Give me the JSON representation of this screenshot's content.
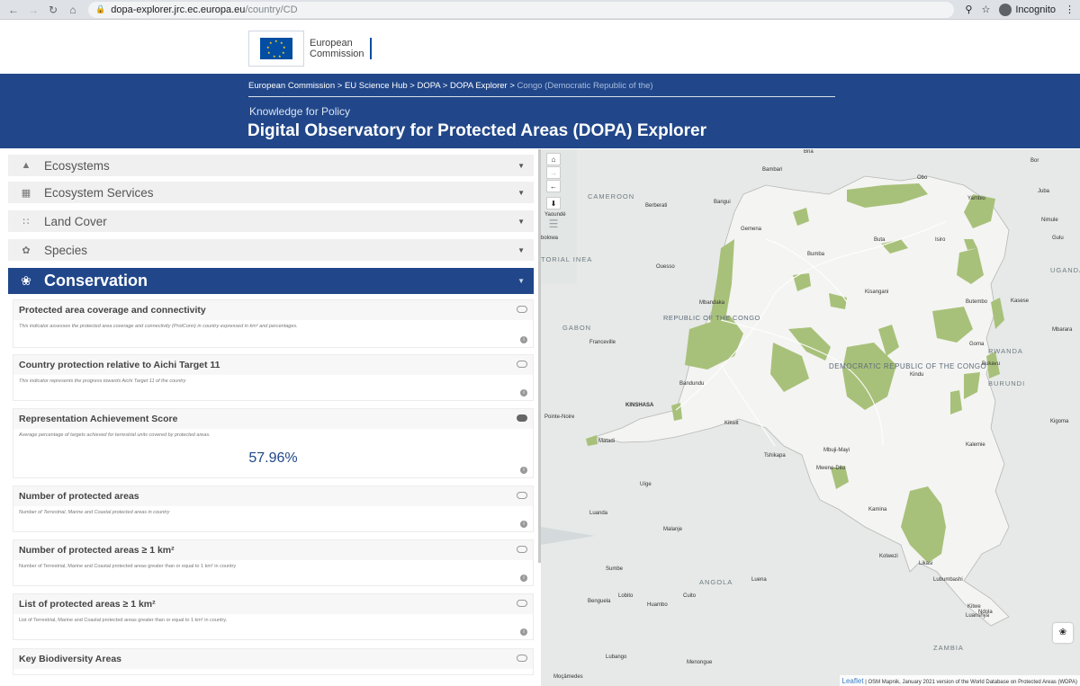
{
  "browser": {
    "url_host": "dopa-explorer.jrc.ec.europa.eu",
    "url_path": "/country/CD",
    "incognito_label": "Incognito"
  },
  "header": {
    "logo_line1": "European",
    "logo_line2": "Commission",
    "breadcrumbs": [
      "European Commission",
      "EU Science Hub",
      "DOPA",
      "DOPA Explorer"
    ],
    "breadcrumb_current": "Congo (Democratic Republic of the)",
    "breadcrumb_sep": " > ",
    "subtitle": "Knowledge for Policy",
    "title": "Digital Observatory for Protected Areas (DOPA) Explorer"
  },
  "sections": {
    "ecosystems": "Ecosystems",
    "ecosystem_services": "Ecosystem Services",
    "land_cover": "Land Cover",
    "species": "Species",
    "conservation": "Conservation"
  },
  "indicators": [
    {
      "title": "Protected area coverage and connectivity",
      "desc": "This indicator assesses the protected area coverage and connectivity (ProtConn) in country expressed in km² and percentages."
    },
    {
      "title": "Country protection relative to Aichi Target 11",
      "desc": "This indicator represents the progress towards Aichi Target 11 of the country"
    },
    {
      "title": "Representation Achievement Score",
      "desc": "Average percentage of targets achieved for terrestrial units covered by protected areas.",
      "value": "57.96%"
    },
    {
      "title": "Number of protected areas",
      "desc": "Number of Terrestrial, Marine and Coastal protected areas in country"
    },
    {
      "title": "Number of protected areas ≥ 1 km²",
      "desc": "Number of Terrestrial, Marine and Coastal protected areas greater than or equal to 1 km² in country"
    },
    {
      "title": "List of protected areas ≥ 1 km²",
      "desc": "List of Terrestrial, Marine and Coastal protected areas greater than or equal to 1 km² in country."
    },
    {
      "title": "Key Biodiversity Areas",
      "desc": ""
    }
  ],
  "map": {
    "country_label": "DEMOCRATIC REPUBLIC OF THE CONGO",
    "labels": {
      "cameroon": "CAMEROON",
      "gabon": "GABON",
      "angola": "ANGOLA",
      "zambia": "ZAMBIA",
      "uganda": "UGANDA",
      "rwanda": "RWANDA",
      "burundi": "BURUNDI",
      "rep_congo": "REPUBLIC OF THE CONGO",
      "eq_guinea_partial": "TORIAL INEA",
      "kinshasa": "KINSHASA",
      "bria": "Bria",
      "bambari": "Bambari",
      "bangui": "Bangui",
      "berberati": "Berberati",
      "yaounde": "Yaoundé",
      "ebolowa": "bolowa",
      "ouesso": "Ouesso",
      "obo": "Obo",
      "yambio": "Yambio",
      "juba": "Juba",
      "bor": "Bor",
      "nimule": "Nimule",
      "gulu": "Gulu",
      "gemena": "Gemena",
      "buta": "Buta",
      "isiro": "Isiro",
      "bumba": "Bumba",
      "kisangani": "Kisangani",
      "mbandaka": "Mbandaka",
      "butembo": "Butembo",
      "kasese": "Kasese",
      "goma": "Goma",
      "bukavu": "Bukavu",
      "kindu": "Kindu",
      "franceville": "Franceville",
      "bandundu": "Bandundu",
      "kikwit": "Kikwit",
      "pointe_noire": "Pointe-Noire",
      "matadi": "Matadi",
      "tshikapa": "Tshikapa",
      "mbuji_mayi": "Mbuji-Mayi",
      "mwene_ditu": "Mwene-Ditu",
      "kalemie": "Kalemie",
      "uige": "Uíge",
      "luanda": "Luanda",
      "malanje": "Malanje",
      "kamina": "Kamina",
      "sumbe": "Sumbe",
      "kolwezi": "Kolwezi",
      "likasi": "Likasi",
      "lubumbashi": "Lubumbashi",
      "luena": "Luena",
      "lobito": "Lobito",
      "benguela": "Benguela",
      "huambo": "Huambo",
      "cuito": "Cuito",
      "kitwe": "Kitwe",
      "ndola": "Ndola",
      "luanshya": "Luanshya",
      "lubango": "Lubango",
      "menongue": "Menongue",
      "mocamedes": "Moçâmedes",
      "mbarara": "Mbarara",
      "kigoma": "Kigoma"
    },
    "attribution_leaflet": "Leaflet",
    "attribution_text": " | OSM Mapnik, January 2021 version of the World Database on Protected Areas (WDPA)",
    "colors": {
      "land": "#f4f4f2",
      "water": "#d4dadc",
      "protected": "#a8c17a"
    }
  }
}
